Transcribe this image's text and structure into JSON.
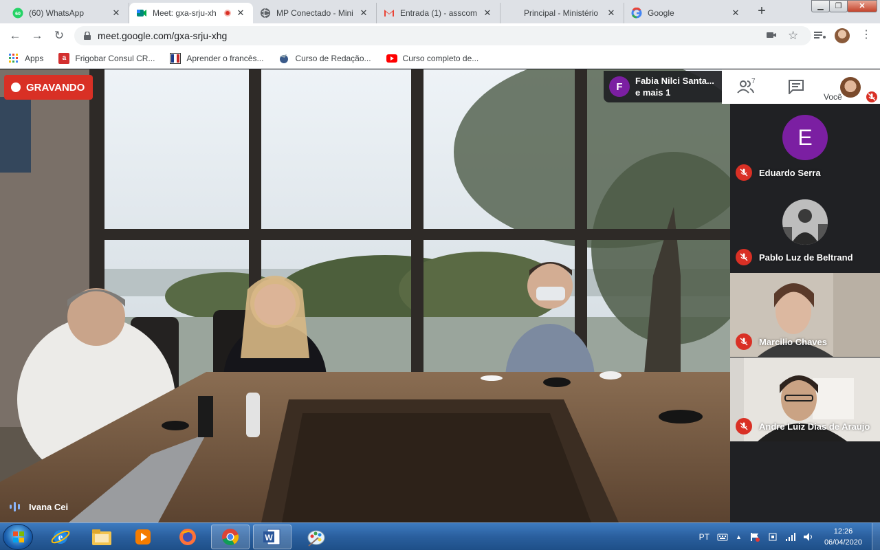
{
  "browser": {
    "tabs": [
      {
        "title": "(60) WhatsApp",
        "icon": "whatsapp-icon",
        "active": false
      },
      {
        "title": "Meet: gxa-srju-xh",
        "icon": "meet-icon",
        "active": true
      },
      {
        "title": "MP Conectado - Mini",
        "icon": "globe-icon",
        "active": false
      },
      {
        "title": "Entrada (1) - asscom",
        "icon": "gmail-icon",
        "active": false
      },
      {
        "title": "Principal - Ministério",
        "icon": "blank-icon",
        "active": false
      },
      {
        "title": "Google",
        "icon": "google-icon",
        "active": false
      }
    ],
    "url": "meet.google.com/gxa-srju-xhg",
    "bookmarks": [
      {
        "label": "Apps",
        "icon": "apps-grid-icon"
      },
      {
        "label": "Frigobar Consul CR...",
        "icon": "bookmark-a-icon"
      },
      {
        "label": "Aprender o francês...",
        "icon": "bookmark-flag-icon"
      },
      {
        "label": "Curso de Redação...",
        "icon": "bookmark-globe-icon"
      },
      {
        "label": "Curso completo de...",
        "icon": "youtube-icon"
      }
    ]
  },
  "meet": {
    "recording_label": "GRAVANDO",
    "presenter": {
      "initial": "F",
      "line1": "Fabia Nilci Santa...",
      "line2": "e mais 1"
    },
    "participant_count": "7",
    "you_label": "Você",
    "active_speaker": "Ivana Cei",
    "participants": [
      {
        "name": "Eduardo Serra",
        "initial": "E",
        "type": "letter"
      },
      {
        "name": "Pablo Luz de Beltrand",
        "type": "photo"
      },
      {
        "name": "Marcilio Chaves",
        "type": "video"
      },
      {
        "name": "Andre Luiz Dias de Araujo",
        "type": "video"
      }
    ],
    "colors": {
      "recording": "#d93025",
      "avatar": "#7b1fa2",
      "panel": "#202124"
    }
  },
  "taskbar": {
    "items": [
      "internet-explorer-icon",
      "file-explorer-icon",
      "media-player-icon",
      "firefox-icon",
      "chrome-icon",
      "word-icon",
      "paint-icon"
    ],
    "language": "PT",
    "time": "12:26",
    "date": "06/04/2020"
  }
}
